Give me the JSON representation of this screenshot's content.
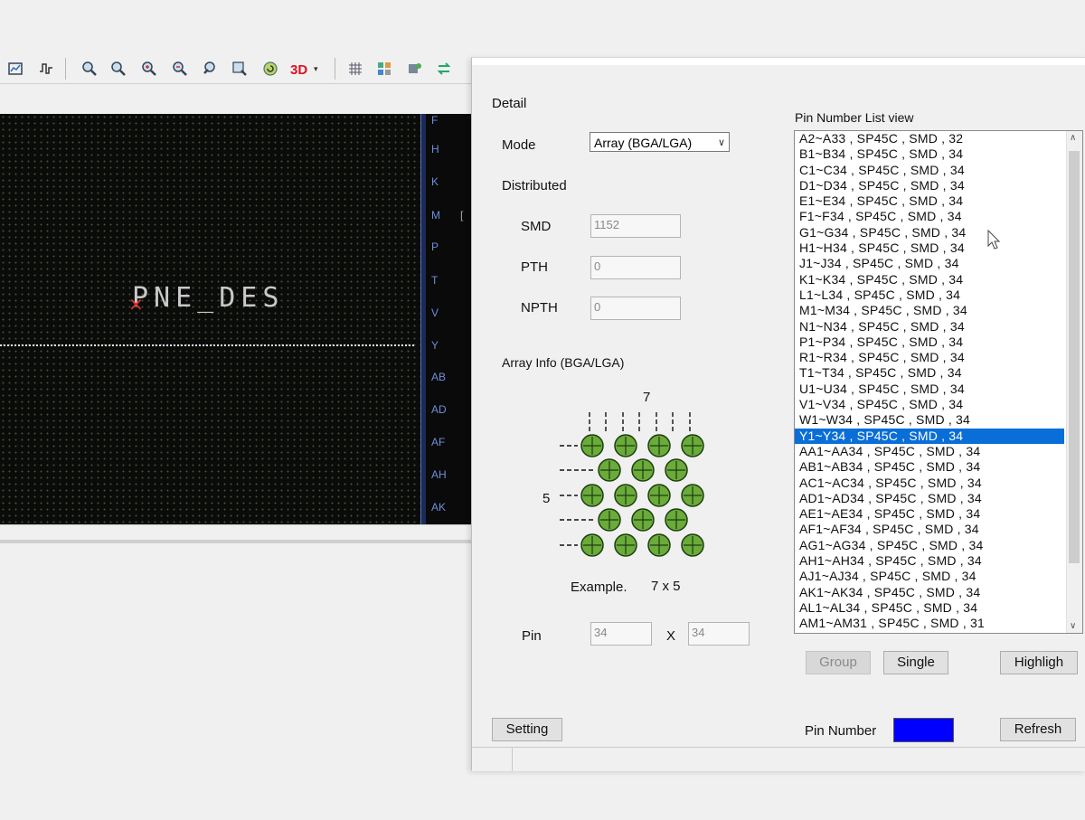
{
  "toolbar": {
    "icons": [
      "chart-icon",
      "waveform-icon",
      "zoom-fit-icon",
      "zoom-in-icon",
      "zoom-plus-icon",
      "zoom-out-icon",
      "zoom-back-icon",
      "zoom-window-icon",
      "refresh-circle-icon",
      "3d-view-icon",
      "grid-icon",
      "layers-icon",
      "settings-icon",
      "swap-icon"
    ]
  },
  "canvas": {
    "overlay_text": "PNE_DES",
    "ruler_labels": [
      "F",
      "H",
      "K",
      "M",
      "P",
      "T",
      "V",
      "Y",
      "AB",
      "AD",
      "AF",
      "AH",
      "AK"
    ],
    "ruler_extra": "["
  },
  "dialog": {
    "detail_label": "Detail",
    "mode_label": "Mode",
    "mode_value": "Array (BGA/LGA)",
    "distributed_label": "Distributed",
    "smd_label": "SMD",
    "smd_value": "1152",
    "pth_label": "PTH",
    "pth_value": "0",
    "npth_label": "NPTH",
    "npth_value": "0",
    "array_info_label": "Array Info (BGA/LGA)",
    "diagram_cols": "7",
    "diagram_rows": "5",
    "example_label": "Example.",
    "example_value": "7 x 5",
    "pin_label": "Pin",
    "pin_x_value": "34",
    "pin_times": "X",
    "pin_y_value": "34",
    "setting_button": "Setting",
    "pin_list_title": "Pin Number List view",
    "pin_list": [
      "A2~A33 , SP45C , SMD , 32",
      "B1~B34 , SP45C , SMD , 34",
      "C1~C34 , SP45C , SMD , 34",
      "D1~D34 , SP45C , SMD , 34",
      "E1~E34 , SP45C , SMD , 34",
      "F1~F34 , SP45C , SMD , 34",
      "G1~G34 , SP45C , SMD , 34",
      "H1~H34 , SP45C , SMD , 34",
      "J1~J34 , SP45C , SMD , 34",
      "K1~K34 , SP45C , SMD , 34",
      "L1~L34 , SP45C , SMD , 34",
      "M1~M34 , SP45C , SMD , 34",
      "N1~N34 , SP45C , SMD , 34",
      "P1~P34 , SP45C , SMD , 34",
      "R1~R34 , SP45C , SMD , 34",
      "T1~T34 , SP45C , SMD , 34",
      "U1~U34 , SP45C , SMD , 34",
      "V1~V34 , SP45C , SMD , 34",
      "W1~W34 , SP45C , SMD , 34",
      "Y1~Y34 , SP45C , SMD , 34",
      "AA1~AA34 , SP45C , SMD , 34",
      "AB1~AB34 , SP45C , SMD , 34",
      "AC1~AC34 , SP45C , SMD , 34",
      "AD1~AD34 , SP45C , SMD , 34",
      "AE1~AE34 , SP45C , SMD , 34",
      "AF1~AF34 , SP45C , SMD , 34",
      "AG1~AG34 , SP45C , SMD , 34",
      "AH1~AH34 , SP45C , SMD , 34",
      "AJ1~AJ34 , SP45C , SMD , 34",
      "AK1~AK34 , SP45C , SMD , 34",
      "AL1~AL34 , SP45C , SMD , 34",
      "AM1~AM31 , SP45C , SMD , 31"
    ],
    "selected_item": "Y1~Y34 , SP45C , SMD , 34",
    "group_button": "Group",
    "single_button": "Single",
    "highlight_button": "Highligh",
    "pin_number_label": "Pin Number",
    "pin_number_color": "#0000ff",
    "refresh_button": "Refresh"
  }
}
